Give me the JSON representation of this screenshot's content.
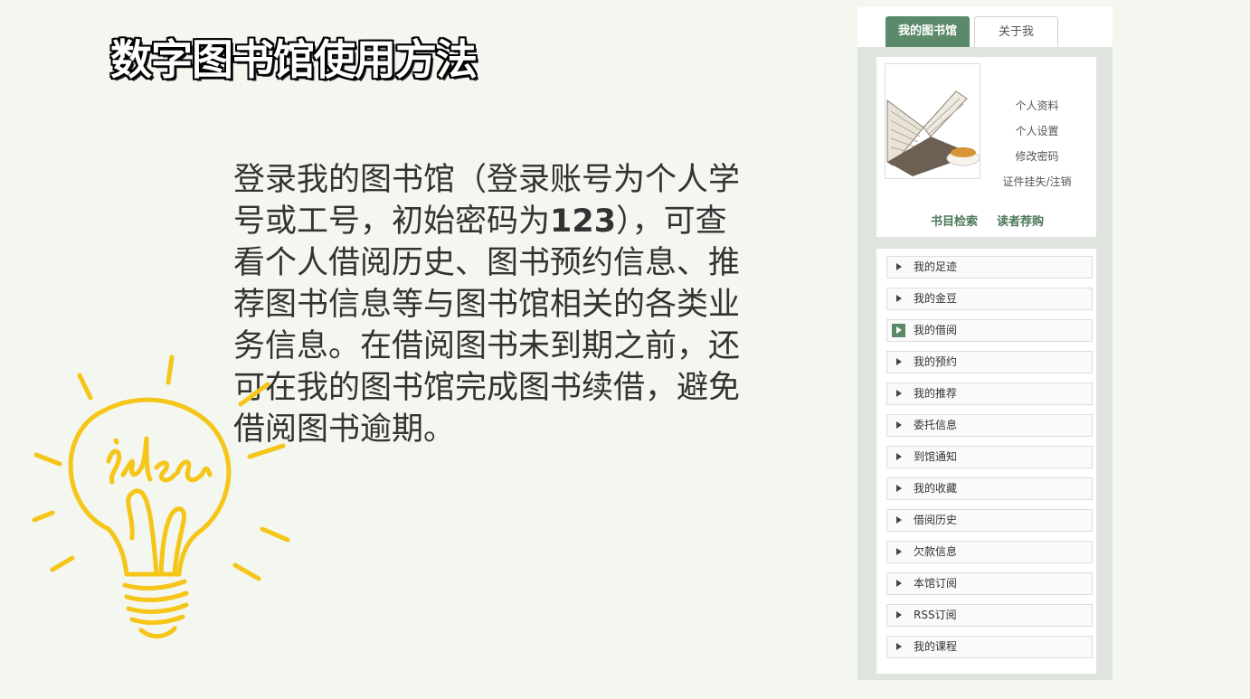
{
  "title": "数字图书馆使用方法",
  "body": {
    "text_before": "登录我的图书馆（登录账号为个人学号或工号，初始密码为",
    "password": "123",
    "text_after": "），可查看个人借阅历史、图书预约信息、推荐图书信息等与图书馆相关的各类业务信息。在借阅图书未到期之前，还可在我的图书馆完成图书续借，避免借阅图书逾期。"
  },
  "illustration": {
    "icon": "idea-lightbulb-icon",
    "color": "#f5c518"
  },
  "library_panel": {
    "tabs": [
      "我的图书馆",
      "关于我"
    ],
    "profile_links": [
      "个人资料",
      "个人设置",
      "修改密码",
      "证件挂失/注销"
    ],
    "quick_links": [
      "书目检索",
      "读者荐购"
    ],
    "menu_items": [
      "我的足迹",
      "我的金豆",
      "我的借阅",
      "我的预约",
      "我的推荐",
      "委托信息",
      "到馆通知",
      "我的收藏",
      "借阅历史",
      "欠款信息",
      "本馆订阅",
      "RSS订阅",
      "我的课程"
    ],
    "active_item": "我的借阅",
    "accent_color": "#5a8a6a"
  }
}
